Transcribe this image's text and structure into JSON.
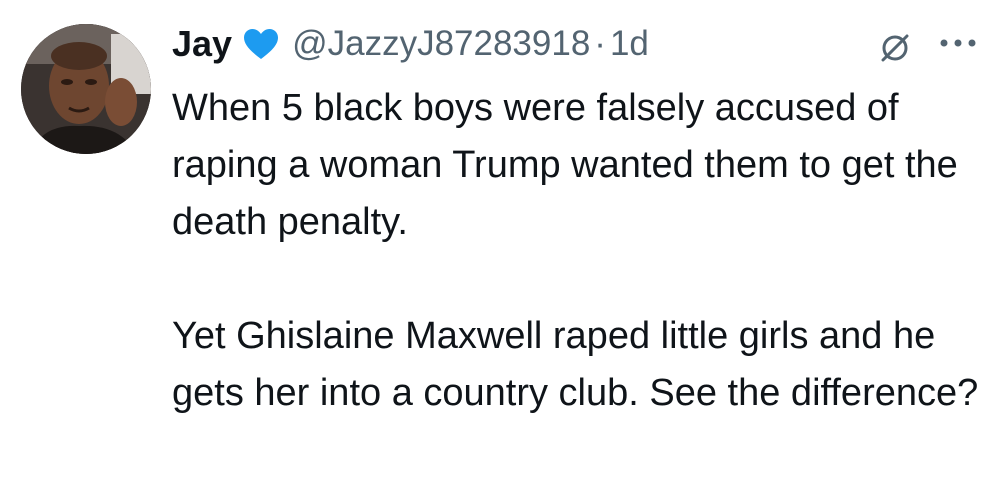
{
  "tweet": {
    "display_name": "Jay",
    "handle": "@JazzyJ87283918",
    "separator": "·",
    "time": "1d",
    "paragraphs": [
      "When 5 black boys were falsely accused of raping a woman Trump wanted them to get the death penalty.",
      "Yet Ghislaine Maxwell raped little girls and he gets her into a country club. See the difference?"
    ]
  },
  "icons": {
    "avatar": "profile-photo",
    "badge": "blue-heart-icon",
    "grok": "grok-icon",
    "more": "more-icon"
  },
  "colors": {
    "text": "#0f1419",
    "secondary": "#536471",
    "heart": "#1d9bf0"
  }
}
